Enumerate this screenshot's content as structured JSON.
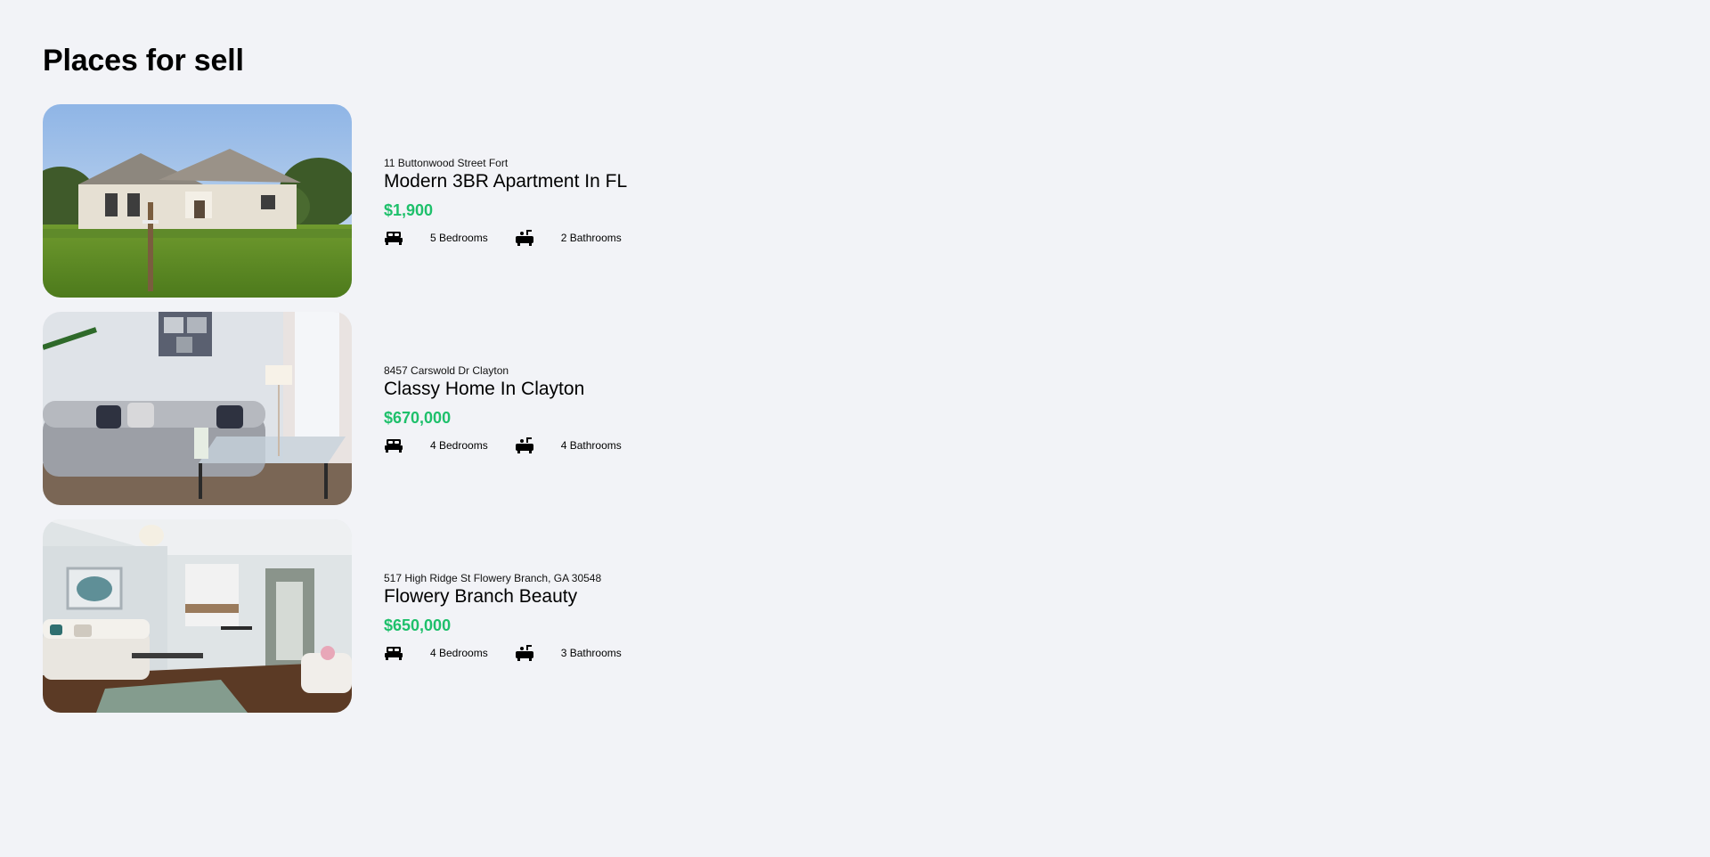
{
  "page": {
    "title": "Places for sell"
  },
  "colors": {
    "background": "#f2f3f7",
    "price": "#1ec06b",
    "text": "#000000"
  },
  "icons": {
    "bedrooms": "bed-icon",
    "bathrooms": "bathtub-icon"
  },
  "listings": [
    {
      "address": "11 Buttonwood Street Fort",
      "name": "Modern 3BR Apartment In FL",
      "price": "$1,900",
      "bedrooms": "5 Bedrooms",
      "bathrooms": "2 Bathrooms",
      "photo": "house-exterior-photo"
    },
    {
      "address": "8457 Carswold Dr Clayton",
      "name": "Classy Home In Clayton",
      "price": "$670,000",
      "bedrooms": "4 Bedrooms",
      "bathrooms": "4 Bathrooms",
      "photo": "living-room-photo"
    },
    {
      "address": "517 High Ridge St Flowery Branch, GA 30548",
      "name": "Flowery Branch Beauty",
      "price": "$650,000",
      "bedrooms": "4 Bedrooms",
      "bathrooms": "3 Bathrooms",
      "photo": "open-plan-interior-photo"
    }
  ]
}
